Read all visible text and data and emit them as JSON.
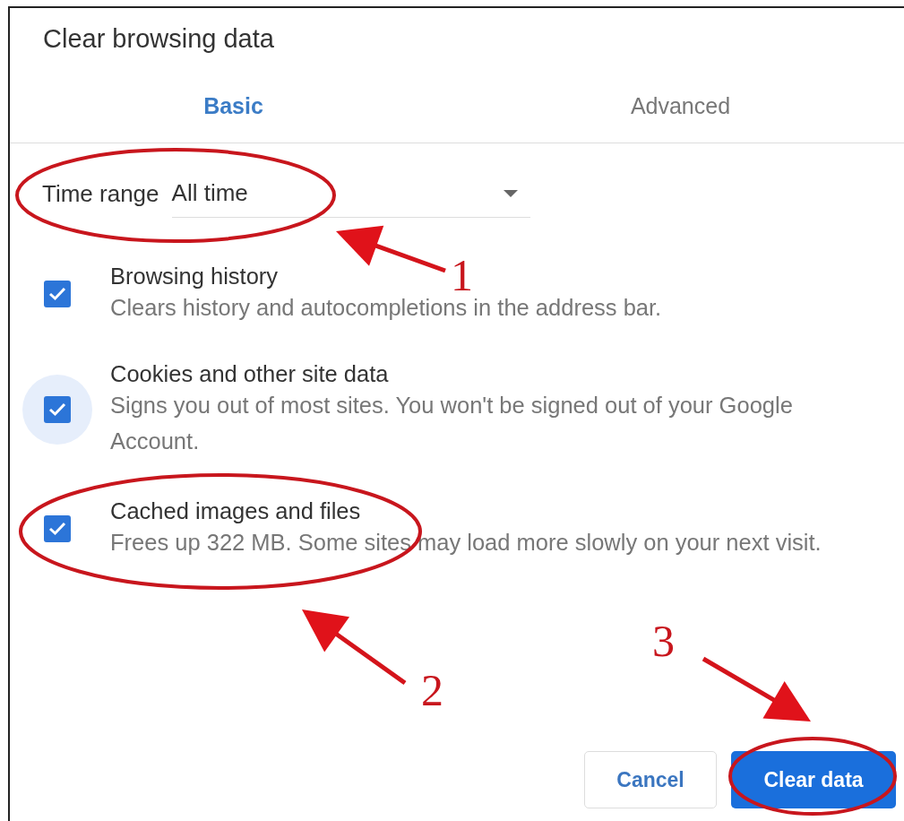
{
  "dialog": {
    "title": "Clear browsing data"
  },
  "tabs": [
    {
      "label": "Basic",
      "selected": true
    },
    {
      "label": "Advanced",
      "selected": false
    }
  ],
  "time_range": {
    "label": "Time range",
    "value": "All time"
  },
  "options": [
    {
      "title": "Browsing history",
      "description": "Clears history and autocompletions in the address bar.",
      "checked": true,
      "focused": false
    },
    {
      "title": "Cookies and other site data",
      "description": "Signs you out of most sites. You won't be signed out of your Google Account.",
      "checked": true,
      "focused": true
    },
    {
      "title": "Cached images and files",
      "description": "Frees up 322 MB. Some sites may load more slowly on your next visit.",
      "checked": true,
      "focused": false
    }
  ],
  "buttons": [
    {
      "label": "Cancel",
      "kind": "secondary"
    },
    {
      "label": "Clear data",
      "kind": "primary"
    }
  ],
  "annotations": [
    {
      "label": "1"
    },
    {
      "label": "2"
    },
    {
      "label": "3"
    }
  ]
}
